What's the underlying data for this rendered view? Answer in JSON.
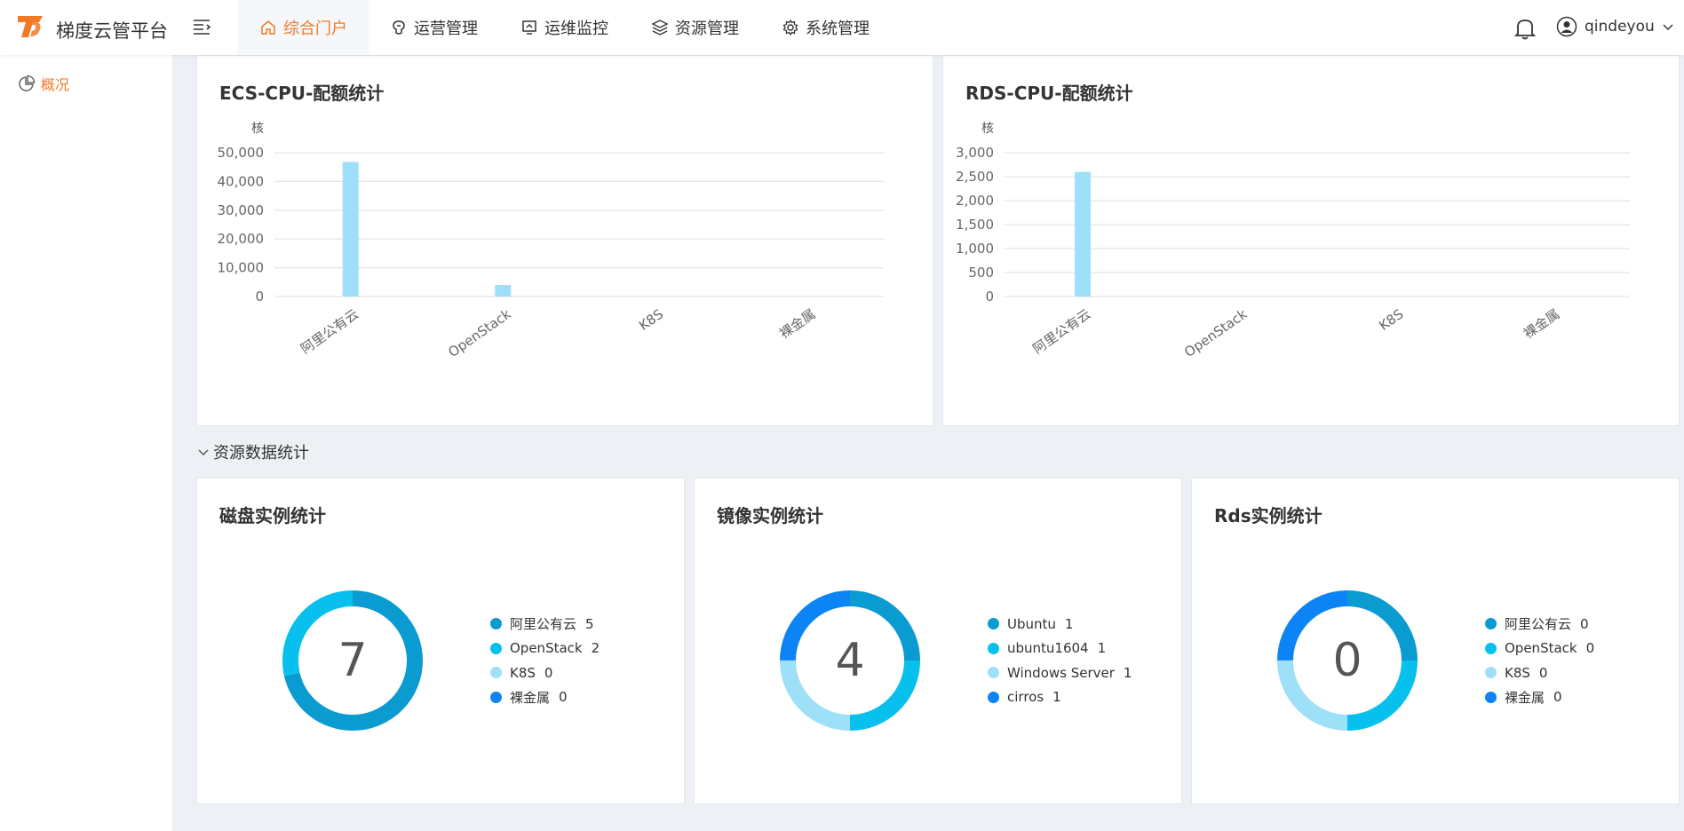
{
  "app": {
    "title": "梯度云管平台"
  },
  "nav": {
    "items": [
      {
        "label": "综合门户",
        "icon": "home-icon",
        "active": true
      },
      {
        "label": "运营管理",
        "icon": "operations-icon",
        "active": false
      },
      {
        "label": "运维监控",
        "icon": "monitor-icon",
        "active": false
      },
      {
        "label": "资源管理",
        "icon": "layers-icon",
        "active": false
      },
      {
        "label": "系统管理",
        "icon": "gear-icon",
        "active": false
      }
    ]
  },
  "user": {
    "name": "qindeyou"
  },
  "sidebar": {
    "items": [
      {
        "label": "概况",
        "icon": "pie-chart-icon"
      }
    ]
  },
  "section": {
    "label": "资源数据统计"
  },
  "colors": {
    "accent": "#f07a28",
    "bar": "#9ee0f8",
    "series": [
      "#0a9bd1",
      "#08c0ee",
      "#9ee0f8",
      "#0d84f5"
    ]
  },
  "chart_data": [
    {
      "type": "bar",
      "title": "ECS-CPU-配额统计",
      "ylabel": "核",
      "categories": [
        "阿里公有云",
        "OpenStack",
        "K8S",
        "裸金属"
      ],
      "values": [
        46800,
        4000,
        0,
        0
      ],
      "yticks": [
        "0",
        "10,000",
        "20,000",
        "30,000",
        "40,000",
        "50,000"
      ],
      "ylim": [
        0,
        50000
      ],
      "grid": true
    },
    {
      "type": "bar",
      "title": "RDS-CPU-配额统计",
      "ylabel": "核",
      "categories": [
        "阿里公有云",
        "OpenStack",
        "K8S",
        "裸金属"
      ],
      "values": [
        2600,
        0,
        0,
        0
      ],
      "yticks": [
        "0",
        "500",
        "1,000",
        "1,500",
        "2,000",
        "2,500",
        "3,000"
      ],
      "ylim": [
        0,
        3000
      ],
      "grid": true
    },
    {
      "type": "pie",
      "title": "磁盘实例统计",
      "total": "7",
      "slices": [
        {
          "name": "阿里公有云",
          "value": 5
        },
        {
          "name": "OpenStack",
          "value": 2
        },
        {
          "name": "K8S",
          "value": 0
        },
        {
          "name": "裸金属",
          "value": 0
        }
      ]
    },
    {
      "type": "pie",
      "title": "镜像实例统计",
      "total": "4",
      "slices": [
        {
          "name": "Ubuntu",
          "value": 1
        },
        {
          "name": "ubuntu1604",
          "value": 1
        },
        {
          "name": "Windows Server",
          "value": 1
        },
        {
          "name": "cirros",
          "value": 1
        }
      ]
    },
    {
      "type": "pie",
      "title": "Rds实例统计",
      "total": "0",
      "slices": [
        {
          "name": "阿里公有云",
          "value": 0
        },
        {
          "name": "OpenStack",
          "value": 0
        },
        {
          "name": "K8S",
          "value": 0
        },
        {
          "name": "裸金属",
          "value": 0
        }
      ]
    }
  ]
}
